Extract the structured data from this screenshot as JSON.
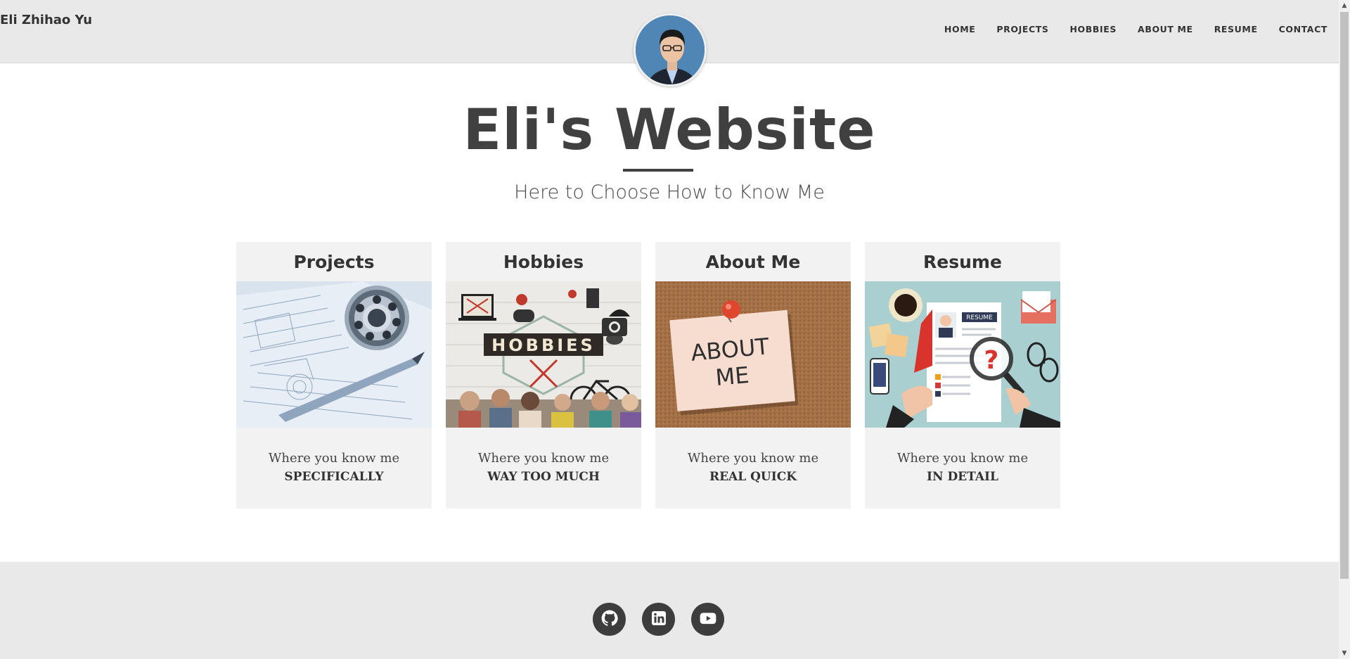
{
  "brand": "Eli Zhihao Yu",
  "nav": [
    "HOME",
    "PROJECTS",
    "HOBBIES",
    "ABOUT ME",
    "RESUME",
    "CONTACT"
  ],
  "hero": {
    "title": "Eli's Website",
    "subtitle": "Here to Choose How to Know Me"
  },
  "cards": [
    {
      "title": "Projects",
      "line1": "Where you know me",
      "line2": "SPECIFICALLY"
    },
    {
      "title": "Hobbies",
      "line1": "Where you know me",
      "line2": "WAY TOO MUCH"
    },
    {
      "title": "About Me",
      "line1": "Where you know me",
      "line2": "REAL QUICK"
    },
    {
      "title": "Resume",
      "line1": "Where you know me",
      "line2": "IN DETAIL"
    }
  ],
  "image_text": {
    "hobbies_banner": "HOBBIES",
    "about_note_1": "ABOUT",
    "about_note_2": "ME",
    "resume_tag": "RESUME"
  },
  "social": [
    "github-icon",
    "linkedin-icon",
    "youtube-icon"
  ],
  "colors": {
    "header_bg": "#e9e9e9",
    "card_bg": "#f2f2f2",
    "text_dark": "#404040",
    "social_bg": "#3d3d3d"
  }
}
